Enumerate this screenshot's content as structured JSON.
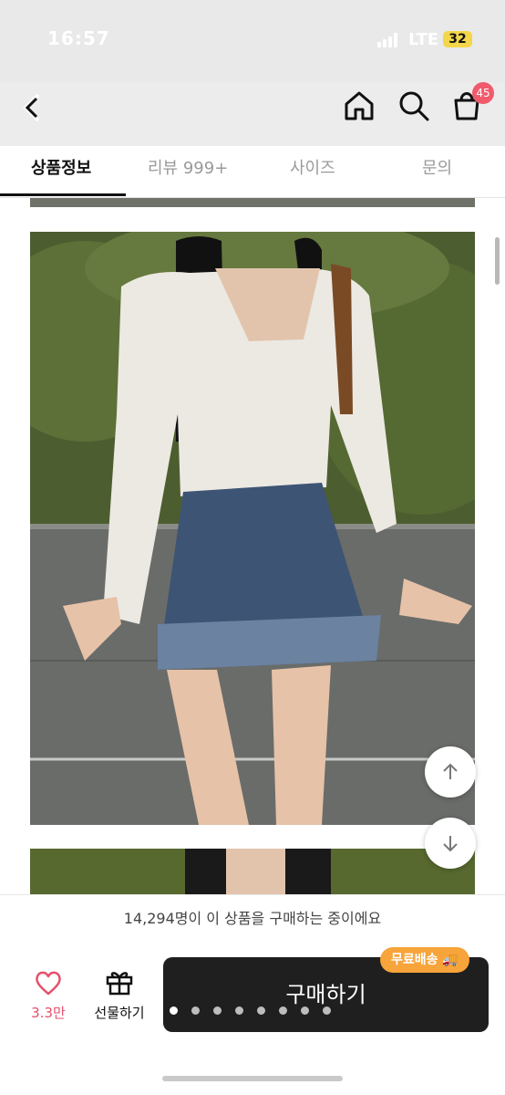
{
  "status_bar": {
    "time": "16:57",
    "network": "LTE",
    "battery": "32"
  },
  "nav": {
    "icons": [
      "back-chevron-icon",
      "home-icon",
      "search-icon",
      "cart-icon"
    ],
    "cart_badge": "45"
  },
  "tabs": [
    {
      "label": "상품정보",
      "active": true
    },
    {
      "label": "리뷰 999+",
      "active": false
    },
    {
      "label": "사이즈",
      "active": false
    },
    {
      "label": "문의",
      "active": false
    }
  ],
  "buyers_text": "14,294명이 이 상품을 구매하는 중이에요",
  "bottom_bar": {
    "like_count": "3.3만",
    "gift_label": "선물하기",
    "buy_label": "구매하기",
    "free_shipping_badge": "무료배송"
  },
  "carousel": {
    "count": 8,
    "active_index": 0
  },
  "colors": {
    "accent_pink": "#f05a6b",
    "buy_button": "#1f1f1f",
    "free_shipping": "#f7a43a"
  }
}
